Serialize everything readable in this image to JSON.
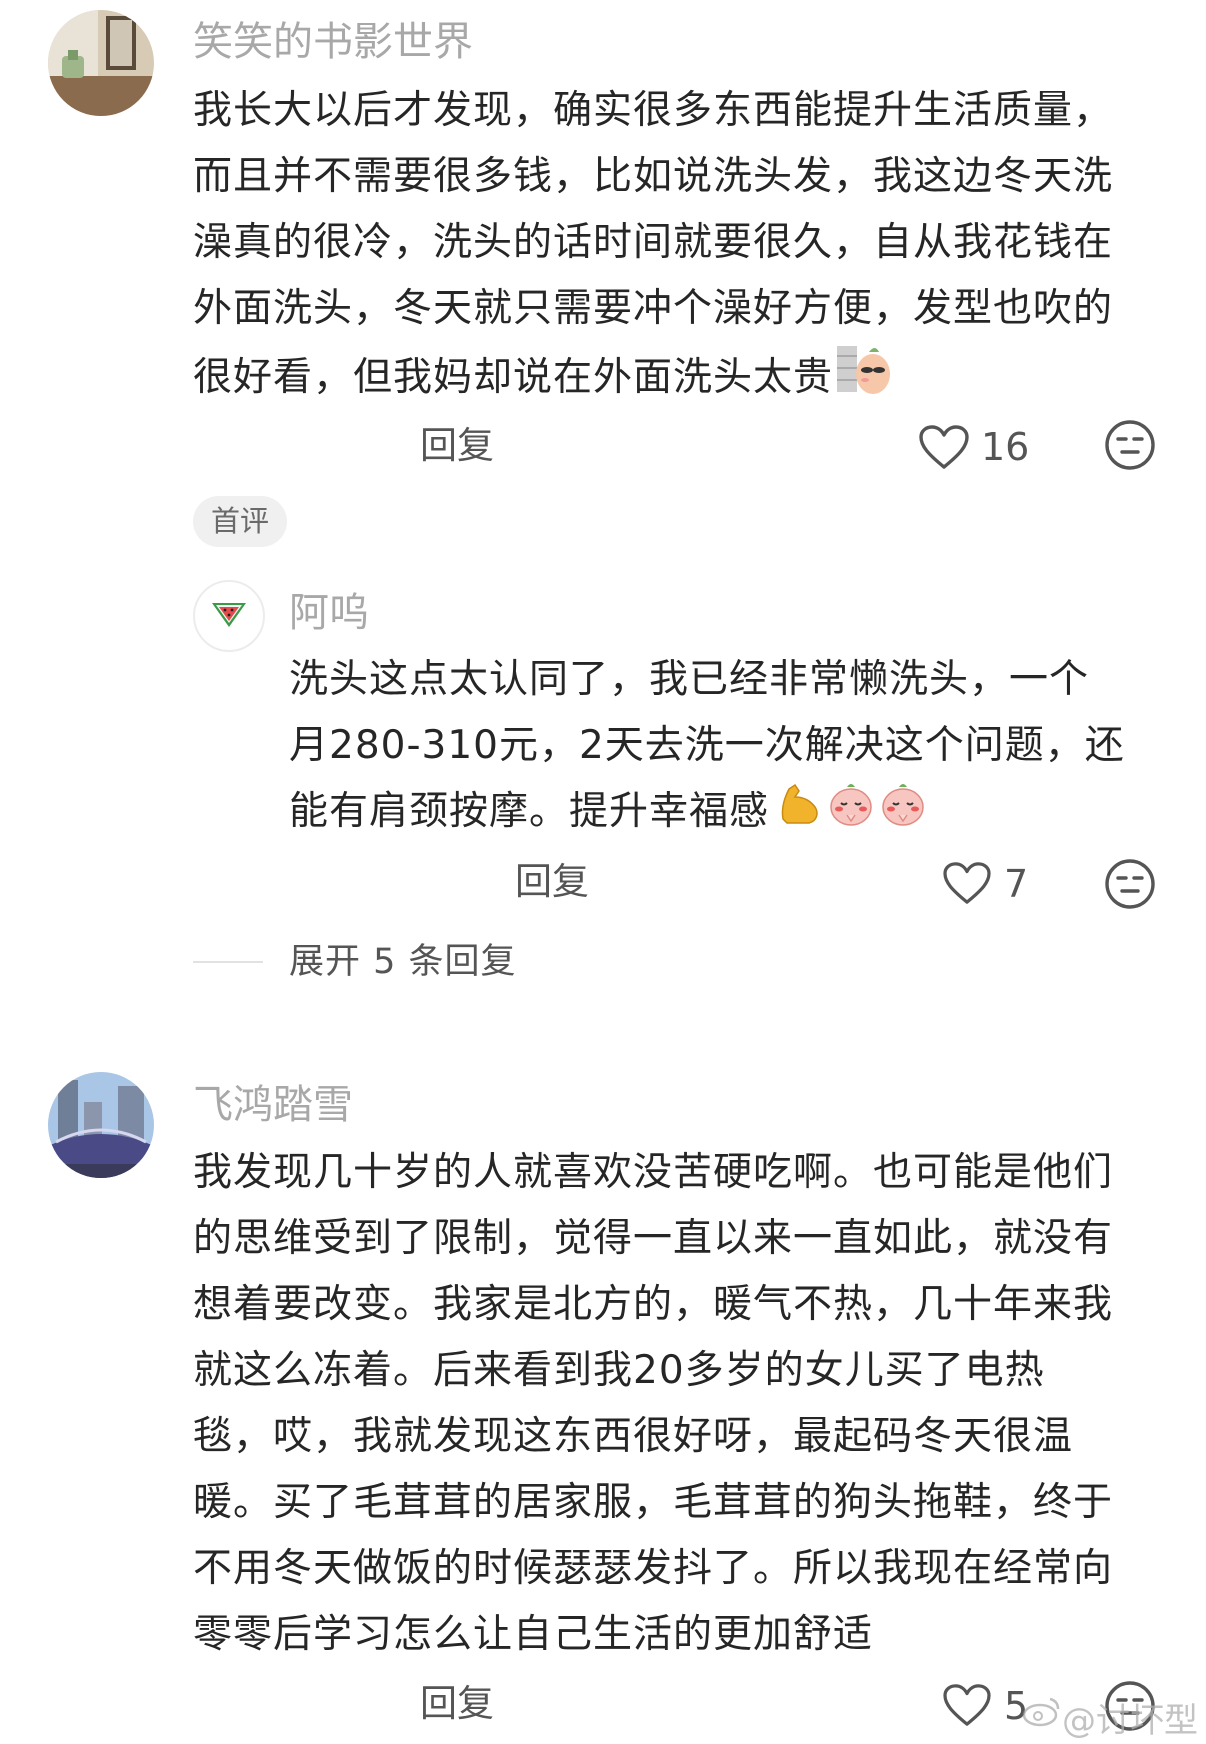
{
  "comments": [
    {
      "username": "笑笑的书影世界",
      "lines": [
        "我长大以后才发现，确实很多东西能提升生活质量，",
        "而且并不需要很多钱，比如说洗头发，我这边冬天洗",
        "澡真的很冷，洗头的话时间就要很久，自从我花钱在",
        "外面洗头，冬天就只需要冲个澡好方便，发型也吹的",
        "很好看，但我妈却说在外面洗头太贵"
      ],
      "reply_label": "回复",
      "like_count": "16",
      "tag": "首评"
    },
    {
      "username": "飞鸿踏雪",
      "lines": [
        "我发现几十岁的人就喜欢没苦硬吃啊。也可能是他们",
        "的思维受到了限制，觉得一直以来一直如此，就没有",
        "想着要改变。我家是北方的，暖气不热，几十年来我",
        "就这么冻着。后来看到我20多岁的女儿买了电热",
        "毯，哎，我就发现这东西很好呀，最起码冬天很温",
        "暖。买了毛茸茸的居家服，毛茸茸的狗头拖鞋，终于",
        "不用冬天做饭的时候瑟瑟发抖了。所以我现在经常向",
        "零零后学习怎么让自己生活的更加舒适"
      ],
      "reply_label": "回复",
      "like_count": "5"
    }
  ],
  "reply": {
    "username": "阿呜",
    "lines": [
      "洗头这点太认同了，我已经非常懒洗头，一个",
      "月280-310元，2天去洗一次解决这个问题，还",
      "能有肩颈按摩。提升幸福感"
    ],
    "reply_label": "回复",
    "like_count": "7"
  },
  "expand_replies": "展开 5 条回复",
  "watermark": "@讨坏型",
  "icons": {
    "like": "heart-outline-icon",
    "react": "neutral-face-icon",
    "reply_avatar": "watermelon-icon"
  },
  "colors": {
    "text": "#262626",
    "muted": "#a8a8a8",
    "icon": "#555555"
  }
}
